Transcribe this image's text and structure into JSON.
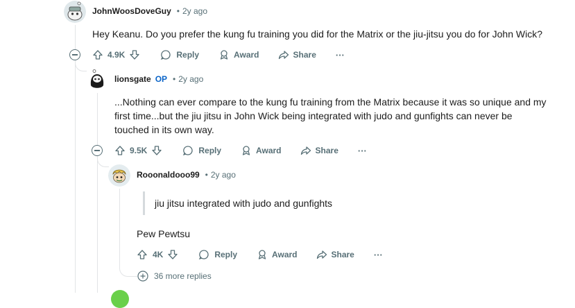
{
  "comments": [
    {
      "author": "JohnWoosDoveGuy",
      "time": "2y ago",
      "body": "Hey Keanu. Do you prefer the kung fu training you did for the Matrix or the jiu-jitsu you do for John Wick?",
      "score": "4.9K",
      "reply": "Reply",
      "award": "Award",
      "share": "Share",
      "more": "···"
    },
    {
      "author": "lionsgate",
      "op_badge": "OP",
      "time": "2y ago",
      "body_lines": [
        "...Nothing can ever compare to the kung fu training from the Matrix because it was so unique and my",
        "first time...but the jiu jitsu in John Wick being integrated with judo and gunfights can never be",
        "touched in its own way."
      ],
      "score": "9.5K",
      "reply": "Reply",
      "award": "Award",
      "share": "Share",
      "more": "···"
    },
    {
      "author": "Rooonaldooo99",
      "time": "2y ago",
      "quote": "jiu jitsu integrated with judo and gunfights",
      "body": "Pew Pewtsu",
      "score": "4K",
      "reply": "Reply",
      "award": "Award",
      "share": "Share",
      "more": "···"
    }
  ],
  "more_replies": "36 more replies",
  "colors": {
    "text": "#1c1c1c",
    "muted": "#576f76",
    "op": "#0a64c8",
    "thread": "#e2e4e6"
  }
}
